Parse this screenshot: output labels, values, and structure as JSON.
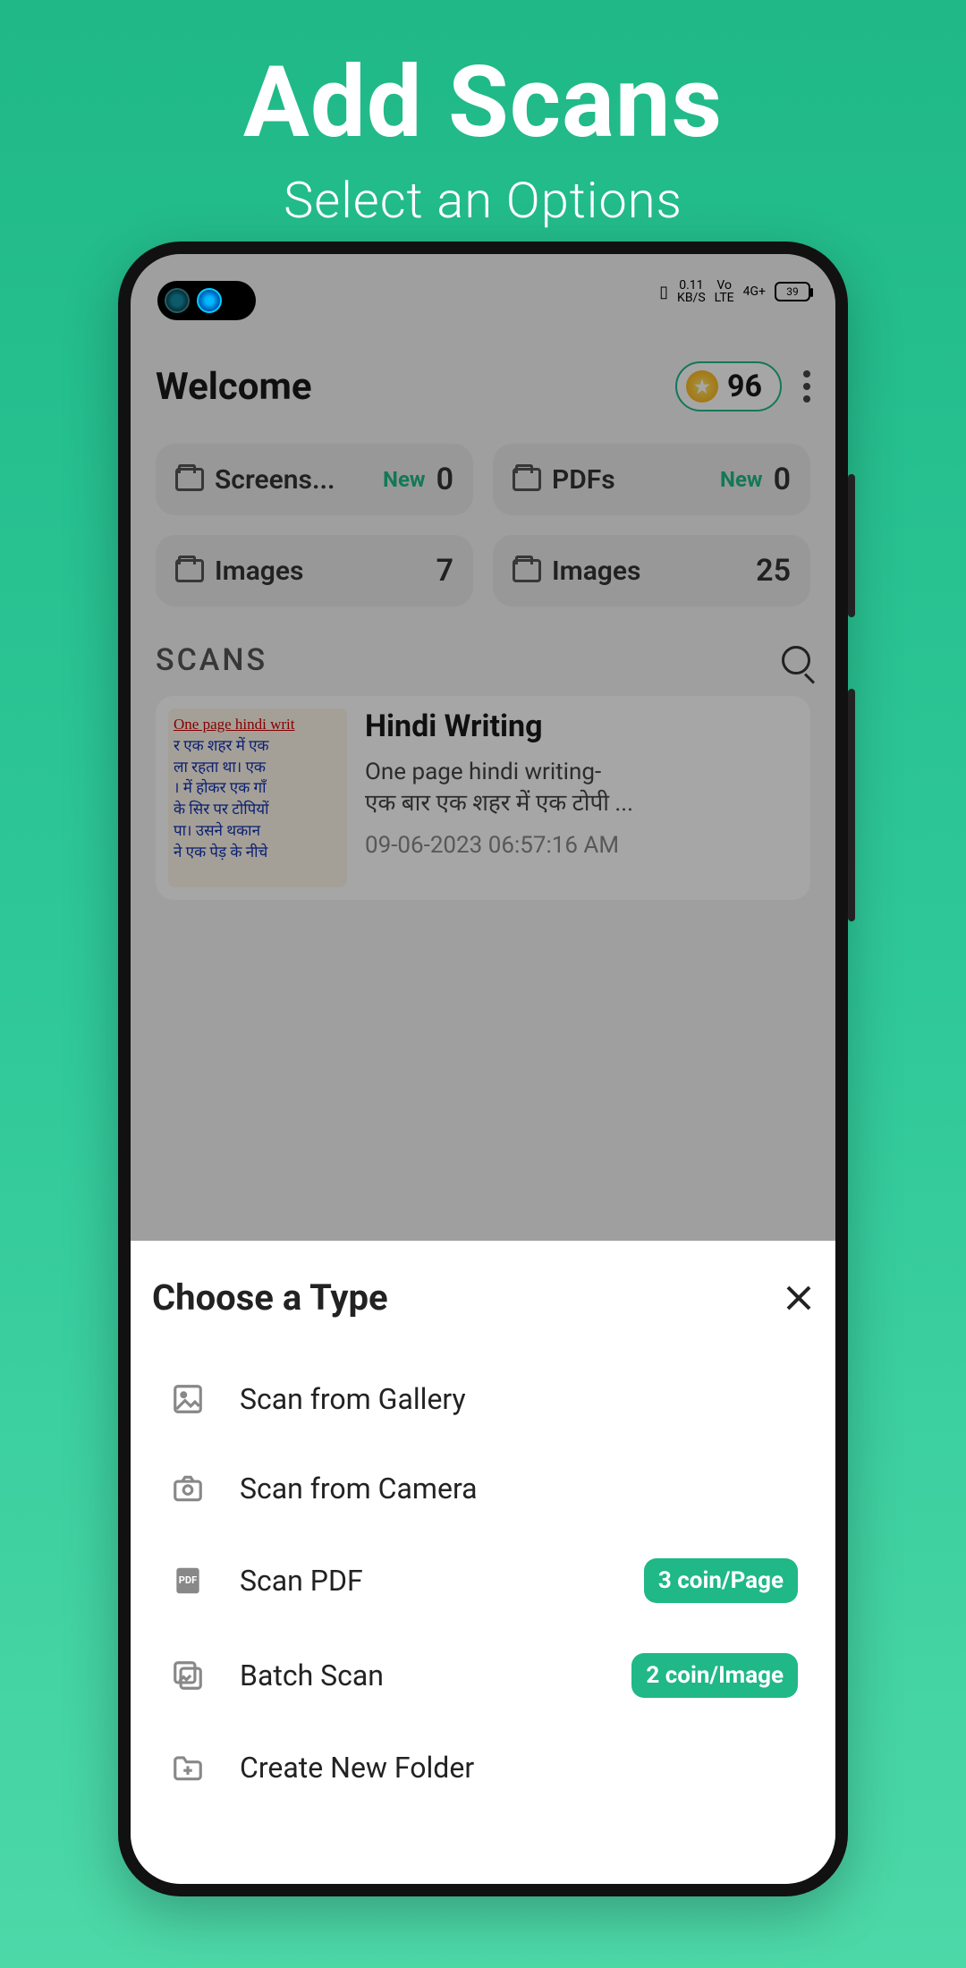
{
  "hero": {
    "title": "Add Scans",
    "subtitle": "Select an Options"
  },
  "statusbar": {
    "speed_top": "0.11",
    "speed_bottom": "KB/S",
    "vo": "Vo",
    "lte": "LTE",
    "signal": "4G+",
    "battery_text": "39"
  },
  "header": {
    "welcome": "Welcome",
    "coins": "96"
  },
  "tiles": [
    {
      "name": "Screens...",
      "new": "New",
      "count": "0"
    },
    {
      "name": "PDFs",
      "new": "New",
      "count": "0"
    },
    {
      "name": "Images",
      "new": "",
      "count": "7"
    },
    {
      "name": "Images",
      "new": "",
      "count": "25"
    }
  ],
  "scans_section": {
    "heading": "SCANS"
  },
  "scan_card": {
    "thumb_line1": "One page hindi writ",
    "title": "Hindi Writing",
    "desc1": "One page hindi writing-",
    "desc2": "एक बार एक शहर में एक टोपी ...",
    "timestamp": "09-06-2023 06:57:16 AM"
  },
  "sheet": {
    "title": "Choose a Type",
    "items": [
      {
        "icon": "image-icon",
        "label": "Scan from Gallery",
        "badge": ""
      },
      {
        "icon": "camera-icon",
        "label": "Scan from Camera",
        "badge": ""
      },
      {
        "icon": "pdf-icon",
        "label": "Scan PDF",
        "badge": "3 coin/Page"
      },
      {
        "icon": "batch-icon",
        "label": "Batch Scan",
        "badge": "2 coin/Image"
      },
      {
        "icon": "folder-plus-icon",
        "label": "Create New Folder",
        "badge": ""
      }
    ]
  }
}
